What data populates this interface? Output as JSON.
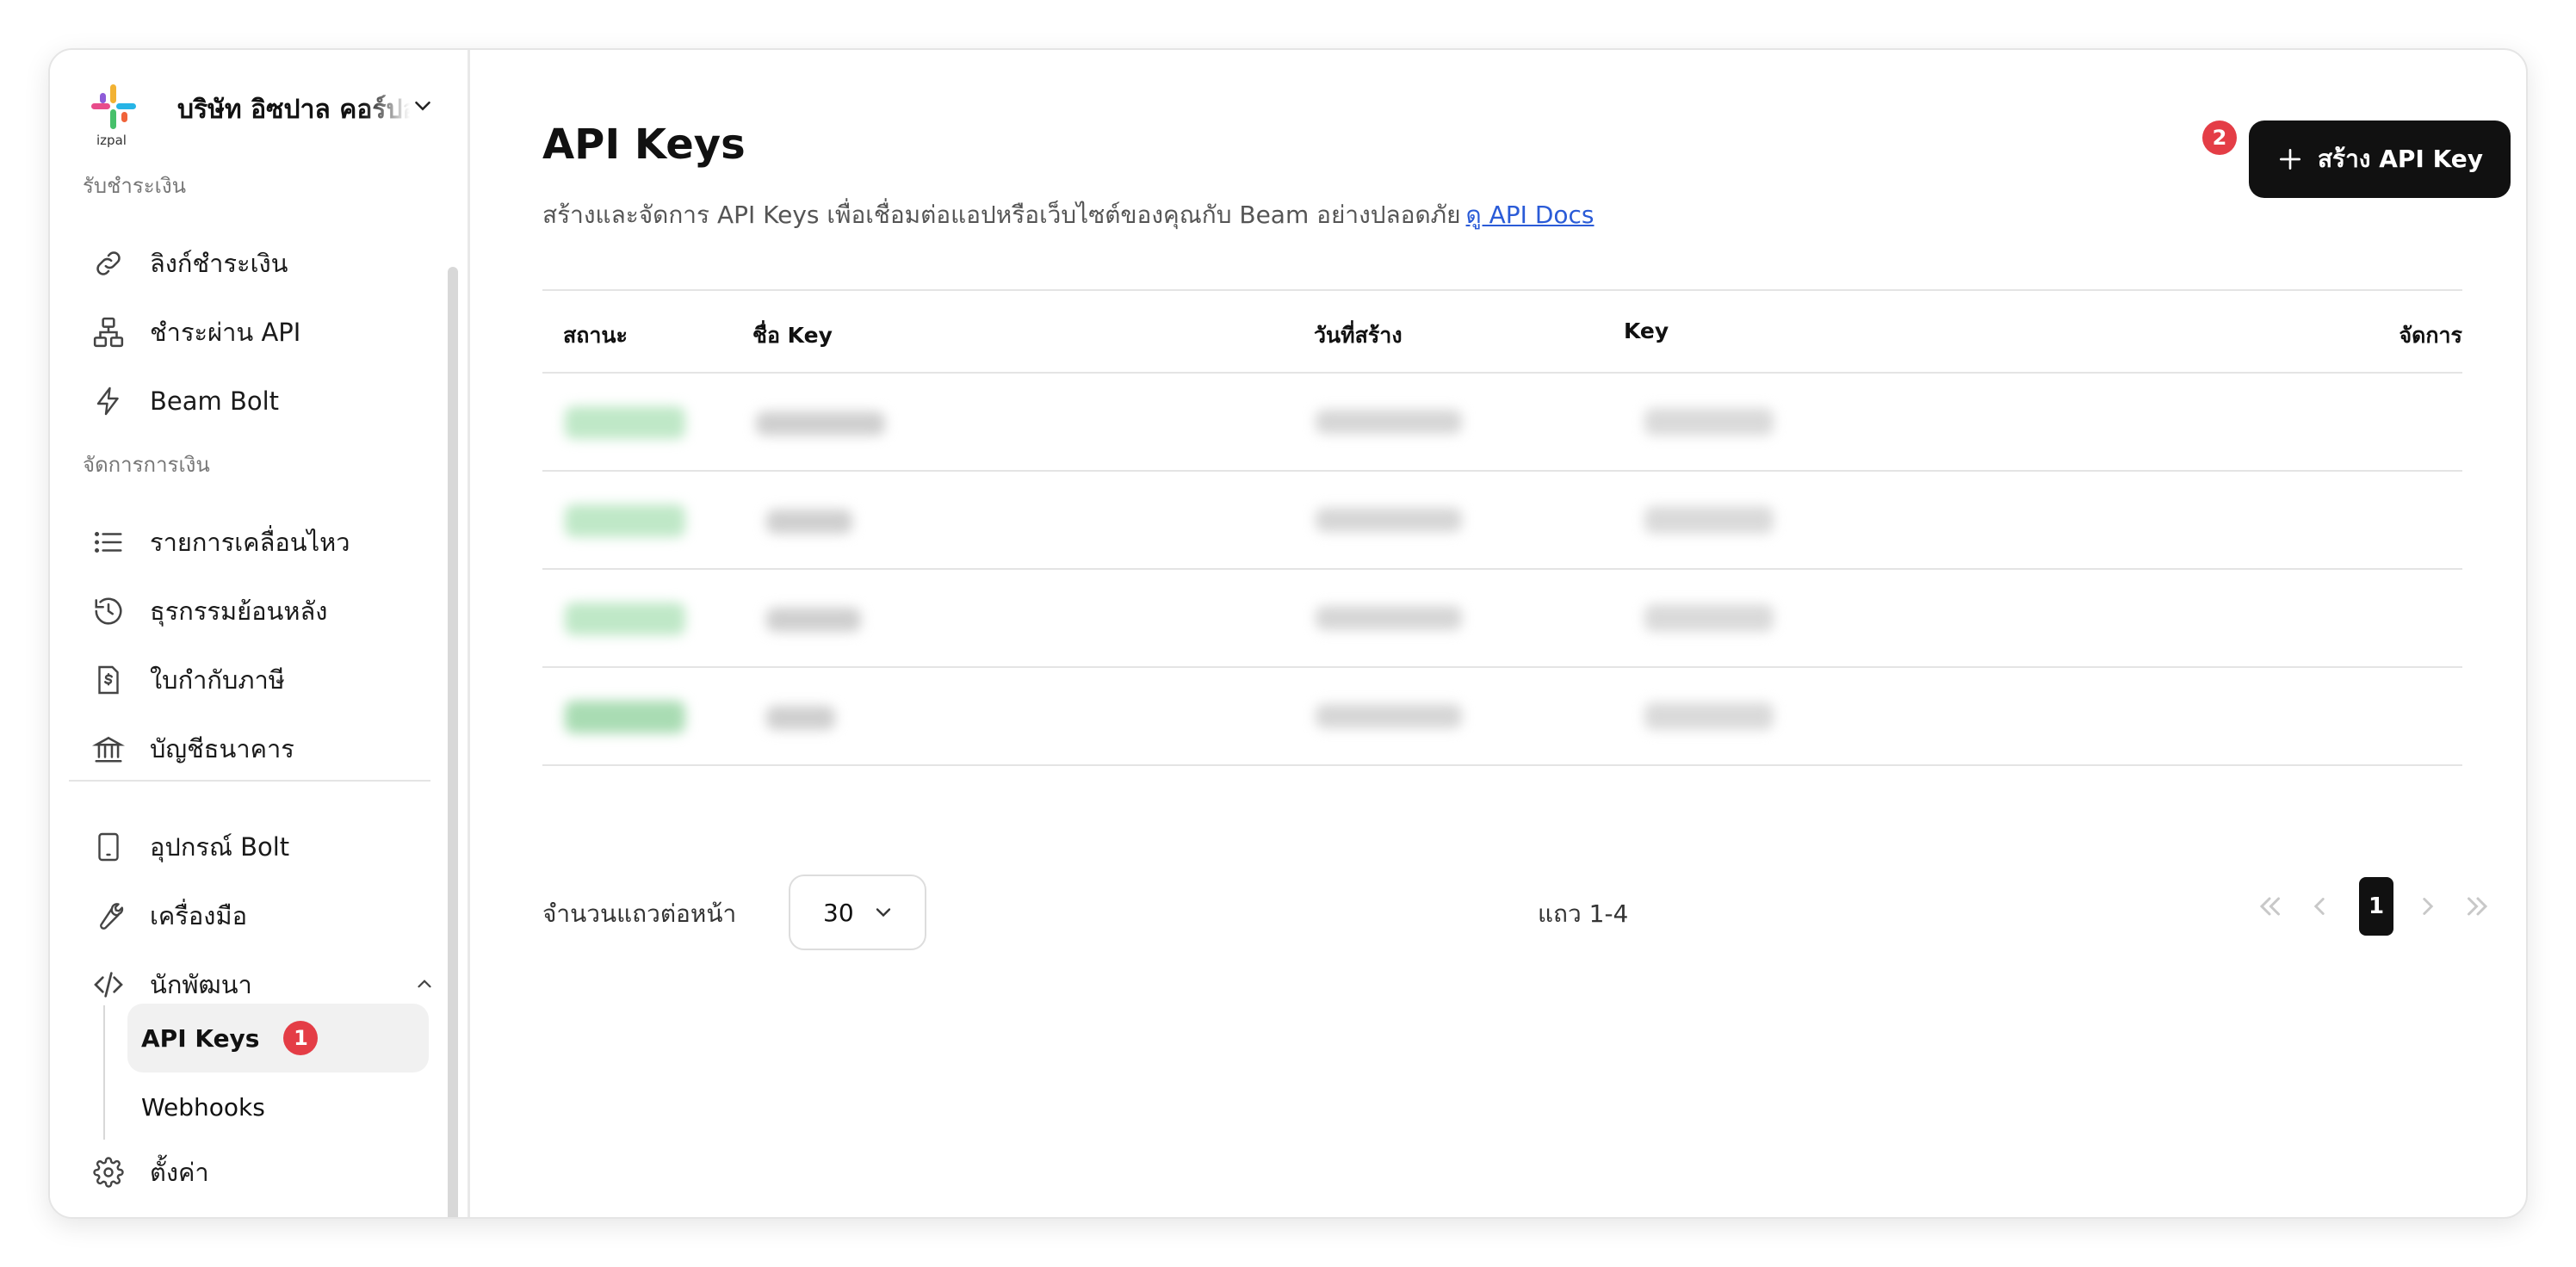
{
  "app": {
    "company_name": "บริษัท อิซปาล คอร์ปอเรชั่น",
    "logo_text": "izpal"
  },
  "sidebar": {
    "sections": [
      {
        "label": "รับชำระเงิน"
      },
      {
        "label": "จัดการการเงิน"
      }
    ],
    "items": [
      {
        "label": "ลิงก์ชำระเงิน",
        "icon": "link-icon"
      },
      {
        "label": "ชำระผ่าน API",
        "icon": "network-icon"
      },
      {
        "label": "Beam Bolt",
        "icon": "bolt-icon"
      },
      {
        "label": "รายการเคลื่อนไหว",
        "icon": "list-icon"
      },
      {
        "label": "ธุรกรรมย้อนหลัง",
        "icon": "history-icon"
      },
      {
        "label": "ใบกำกับภาษี",
        "icon": "receipt-icon"
      },
      {
        "label": "บัญชีธนาคาร",
        "icon": "bank-icon"
      },
      {
        "label": "อุปกรณ์ Bolt",
        "icon": "tablet-icon"
      },
      {
        "label": "เครื่องมือ",
        "icon": "wrench-icon"
      },
      {
        "label": "นักพัฒนา",
        "icon": "code-icon"
      },
      {
        "label": "ตั้งค่า",
        "icon": "gear-icon"
      }
    ],
    "developer_sub": [
      {
        "label": "API Keys",
        "active": true,
        "badge": "1"
      },
      {
        "label": "Webhooks",
        "active": false
      }
    ]
  },
  "main": {
    "title": "API Keys",
    "description": "สร้างและจัดการ API Keys เพื่อเชื่อมต่อแอปหรือเว็บไซต์ของคุณกับ Beam อย่างปลอดภัย",
    "docs_link": "ดู API Docs",
    "create_button": "สร้าง API Key",
    "create_badge": "2"
  },
  "table": {
    "columns": [
      "สถานะ",
      "ชื่อ Key",
      "วันที่สร้าง",
      "Key",
      "จัดการ"
    ]
  },
  "pagination": {
    "rows_per_page_label": "จำนวนแถวต่อหน้า",
    "rows_per_page": "30",
    "range": "แถว 1-4",
    "current_page": "1"
  },
  "colors": {
    "primary": "#111111",
    "badge": "#e43d46",
    "link": "#2a5bd7"
  }
}
